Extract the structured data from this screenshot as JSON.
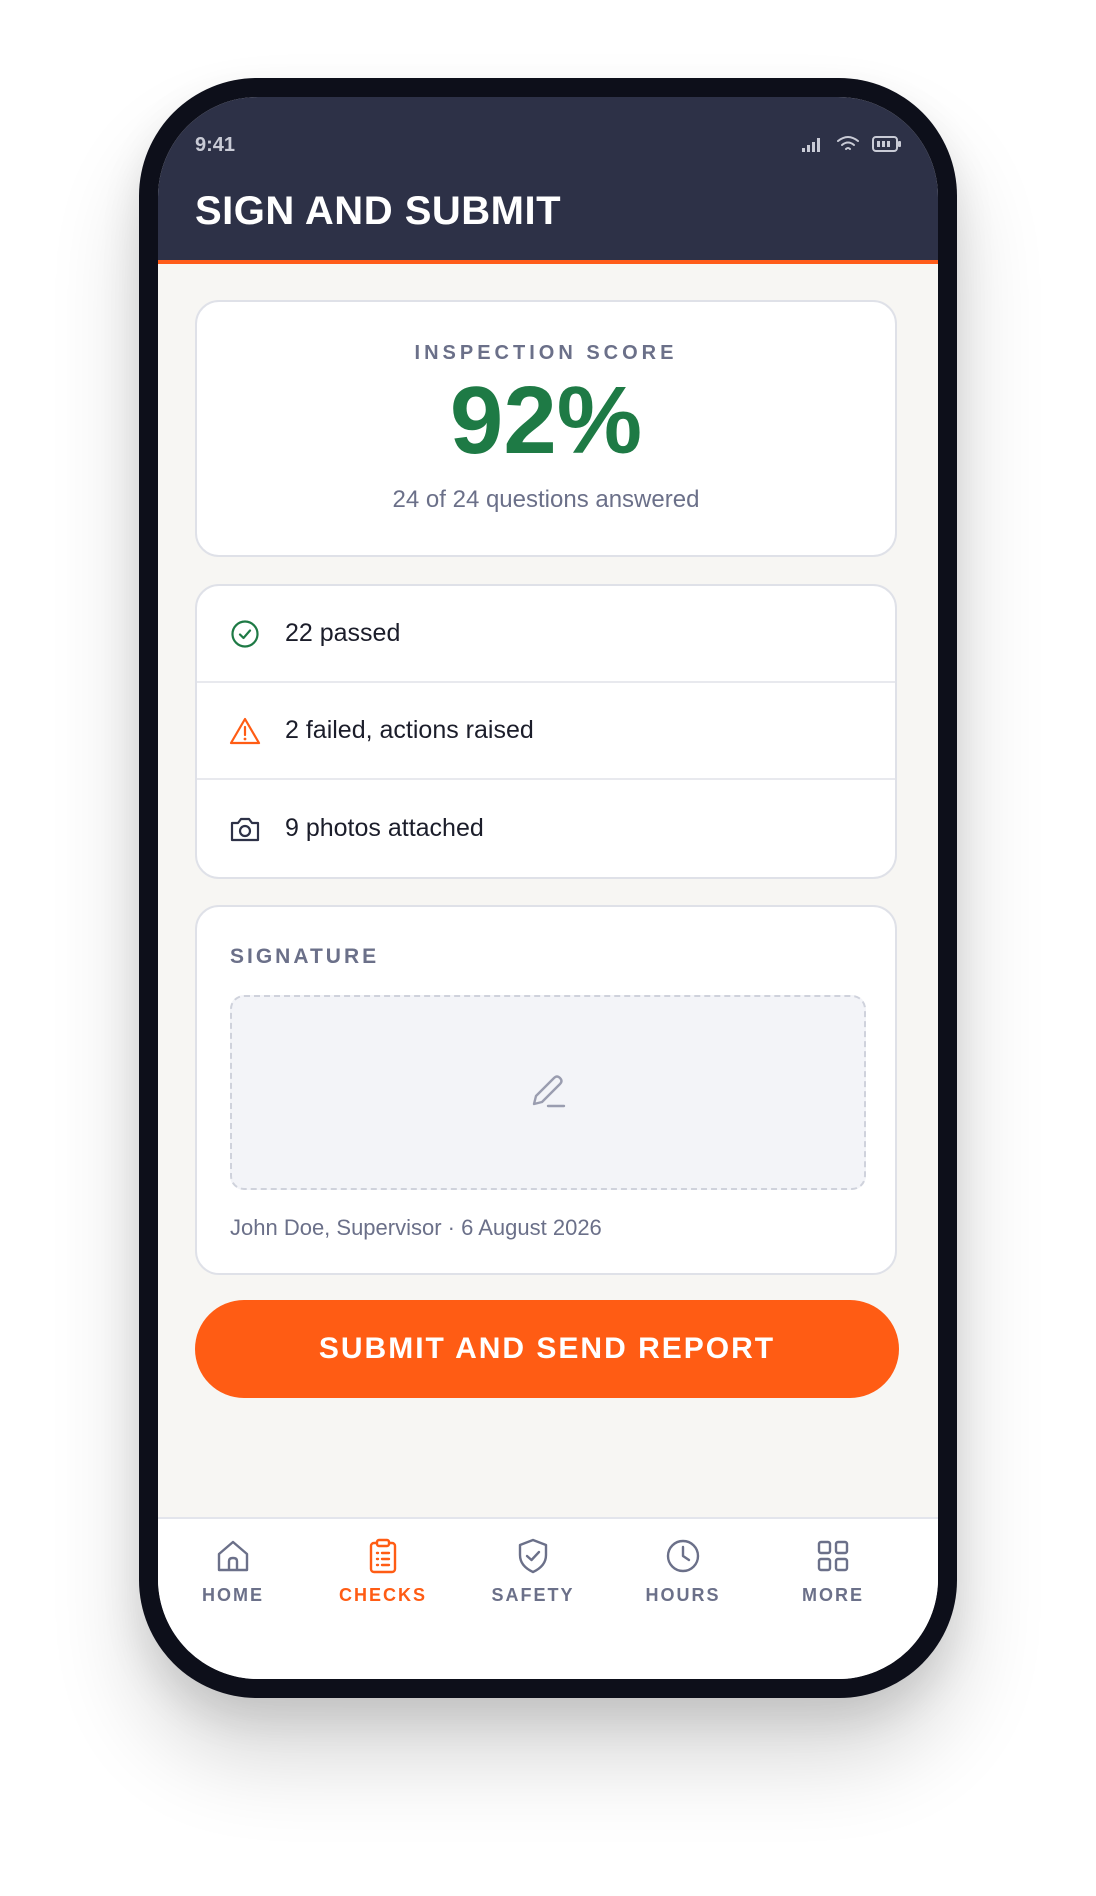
{
  "status_bar": {
    "time": "9:41"
  },
  "header": {
    "title": "SIGN AND SUBMIT"
  },
  "score": {
    "label": "INSPECTION SCORE",
    "value": "92%",
    "subtitle": "24 of 24 questions answered"
  },
  "summary": [
    {
      "icon": "check-circle-icon",
      "text": "22 passed"
    },
    {
      "icon": "warning-triangle-icon",
      "text": "2 failed, actions raised"
    },
    {
      "icon": "camera-icon",
      "text": "9 photos attached"
    }
  ],
  "signature": {
    "label": "SIGNATURE",
    "pad_icon": "pen-icon",
    "caption": "John Doe, Supervisor · 6 August 2026"
  },
  "submit_label": "SUBMIT AND SEND REPORT",
  "tabs": [
    {
      "label": "HOME",
      "icon": "home-icon",
      "active": false
    },
    {
      "label": "CHECKS",
      "icon": "clipboard-icon",
      "active": true
    },
    {
      "label": "SAFETY",
      "icon": "shield-check-icon",
      "active": false
    },
    {
      "label": "HOURS",
      "icon": "clock-icon",
      "active": false
    },
    {
      "label": "MORE",
      "icon": "grid-icon",
      "active": false
    }
  ],
  "colors": {
    "header_bg": "#2d3147",
    "accent": "#ff5c14",
    "score_green": "#1e7a45",
    "muted_text": "#6b7089"
  }
}
